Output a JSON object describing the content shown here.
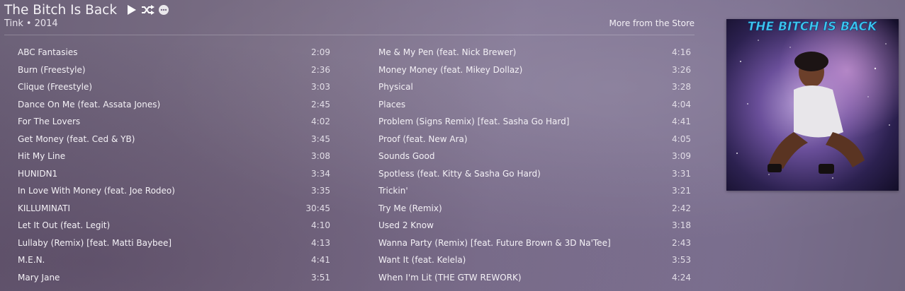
{
  "album": {
    "title": "The Bitch Is Back",
    "artist": "Tink",
    "year": "2014",
    "separator": "•",
    "store_link": "More from the Store",
    "art_text": "THE BITCH IS BACK",
    "controls": [
      "play-icon",
      "shuffle-icon",
      "more-icon"
    ]
  },
  "tracks_left": [
    {
      "name": "ABC Fantasies",
      "duration": "2:09"
    },
    {
      "name": "Burn (Freestyle)",
      "duration": "2:36"
    },
    {
      "name": "Clique (Freestyle)",
      "duration": "3:03"
    },
    {
      "name": "Dance On Me (feat. Assata Jones)",
      "duration": "2:45"
    },
    {
      "name": "For The Lovers",
      "duration": "4:02"
    },
    {
      "name": "Get Money (feat. Ced & YB)",
      "duration": "3:45"
    },
    {
      "name": "Hit My Line",
      "duration": "3:08"
    },
    {
      "name": "HUNIDN1",
      "duration": "3:34"
    },
    {
      "name": "In Love With Money (feat. Joe Rodeo)",
      "duration": "3:35"
    },
    {
      "name": "KILLUMINATI",
      "duration": "30:45"
    },
    {
      "name": "Let It Out (feat. Legit)",
      "duration": "4:10"
    },
    {
      "name": "Lullaby (Remix) [feat. Matti Baybee]",
      "duration": "4:13"
    },
    {
      "name": "M.E.N.",
      "duration": "4:41"
    },
    {
      "name": "Mary Jane",
      "duration": "3:51"
    }
  ],
  "tracks_right": [
    {
      "name": "Me & My Pen (feat. Nick Brewer)",
      "duration": "4:16"
    },
    {
      "name": "Money Money (feat. Mikey Dollaz)",
      "duration": "3:26"
    },
    {
      "name": "Physical",
      "duration": "3:28"
    },
    {
      "name": "Places",
      "duration": "4:04"
    },
    {
      "name": "Problem (Signs Remix) [feat. Sasha Go Hard]",
      "duration": "4:41"
    },
    {
      "name": "Proof (feat. New Ara)",
      "duration": "4:05"
    },
    {
      "name": "Sounds Good",
      "duration": "3:09"
    },
    {
      "name": "Spotless (feat. Kitty & Sasha Go Hard)",
      "duration": "3:31"
    },
    {
      "name": "Trickin'",
      "duration": "3:21"
    },
    {
      "name": "Try Me (Remix)",
      "duration": "2:42"
    },
    {
      "name": "Used 2 Know",
      "duration": "3:18"
    },
    {
      "name": "Wanna Party (Remix) [feat. Future Brown & 3D Na'Tee]",
      "duration": "2:43"
    },
    {
      "name": "Want It (feat. Kelela)",
      "duration": "3:53"
    },
    {
      "name": "When I'm Lit (THE GTW REWORK)",
      "duration": "4:24"
    }
  ]
}
